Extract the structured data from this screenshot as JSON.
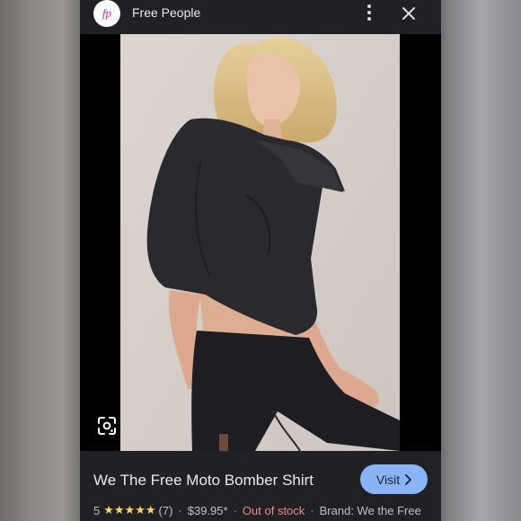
{
  "header": {
    "site_name": "Free People",
    "logo_text": "fp"
  },
  "product": {
    "title": "We The Free Moto Bomber Shirt",
    "visit_label": "Visit",
    "rating": "5",
    "stars": "★★★★★",
    "review_count": "(7)",
    "price": "$39.95*",
    "stock_status": "Out of stock",
    "brand": "Brand: We the Free"
  },
  "icons": {
    "more": "more-vert-icon",
    "close": "close-icon",
    "lens": "google-lens-icon",
    "chevron": "chevron-right-icon"
  },
  "colors": {
    "panel_bg": "#202124",
    "visit_bg": "#8ab4f8",
    "star": "#fdd663",
    "out_of_stock": "#f28b82",
    "logo_text": "#e0207a"
  }
}
